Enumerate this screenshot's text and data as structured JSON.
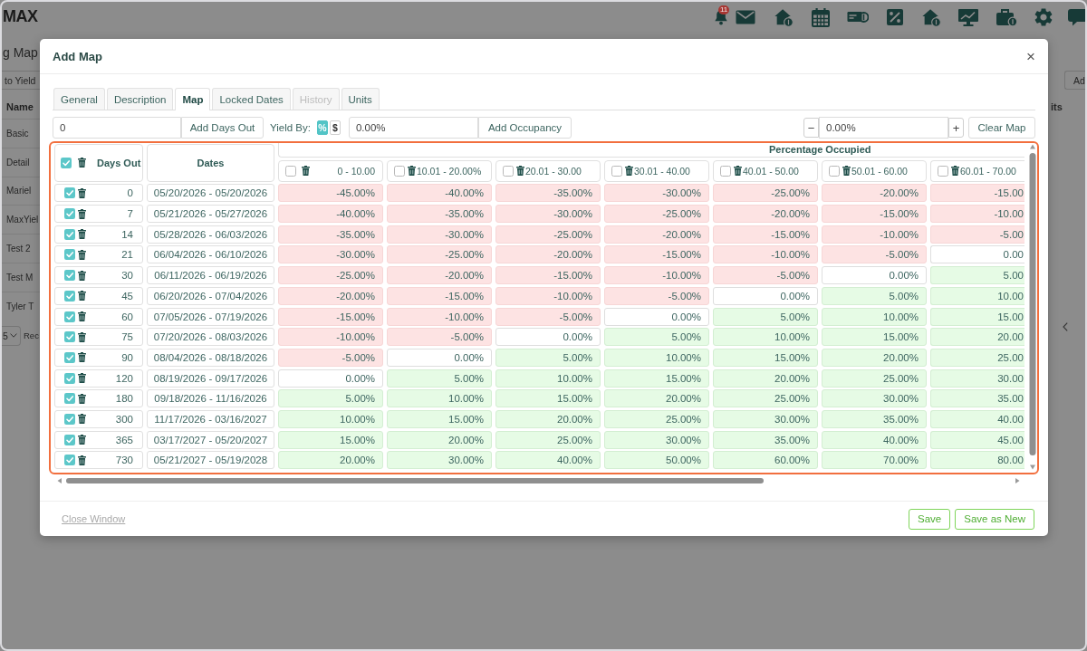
{
  "app_bar": {
    "logo": "MAX",
    "notification_count": "11"
  },
  "background_page": {
    "title": "g Map",
    "yield_button": "to Yield",
    "name_column": "Name",
    "rows": [
      "Basic",
      "Detail",
      "Mariel",
      "MaxYiel",
      "Test 2",
      "Test M",
      "Tyler T"
    ],
    "page_size": "5",
    "records_label": "Rec",
    "add_button": "Ad",
    "column_2": "its"
  },
  "dialog": {
    "title": "Add Map",
    "close": "×",
    "tabs": [
      {
        "label": "General",
        "selected": false,
        "disabled": false
      },
      {
        "label": "Description",
        "selected": false,
        "disabled": false
      },
      {
        "label": "Map",
        "selected": true,
        "disabled": false
      },
      {
        "label": "Locked Dates",
        "selected": false,
        "disabled": false
      },
      {
        "label": "History",
        "selected": false,
        "disabled": true
      },
      {
        "label": "Units",
        "selected": false,
        "disabled": false
      }
    ],
    "toolbar": {
      "days_out_field": {
        "value": "0"
      },
      "add_days_out": "Add Days Out",
      "yield_by_label": "Yield By:",
      "yield_by_options": [
        {
          "label": "%",
          "selected": true
        },
        {
          "label": "$",
          "selected": false
        }
      ],
      "occupancy_field": {
        "value": "0.00%"
      },
      "add_occupancy": "Add Occupancy",
      "decrement": "−",
      "adjust_field": {
        "value": "0.00%"
      },
      "increment": "+",
      "clear_map": "Clear Map"
    },
    "map": {
      "days_header": {
        "label": "Days Out",
        "checked": true
      },
      "dates_header": "Dates",
      "group_header": "Percentage Occupied",
      "columns": [
        {
          "label": "0 - 10.00",
          "checked": false
        },
        {
          "label": "10.01 - 20.00%",
          "checked": false
        },
        {
          "label": "20.01 - 30.00",
          "checked": false
        },
        {
          "label": "30.01 - 40.00",
          "checked": false
        },
        {
          "label": "40.01 - 50.00",
          "checked": false
        },
        {
          "label": "50.01 - 60.00",
          "checked": false
        },
        {
          "label": "60.01 - 70.00",
          "checked": false
        }
      ],
      "rows": [
        {
          "days": "0",
          "checked": true,
          "dates": "05/20/2026 - 05/20/2026",
          "cells": [
            {
              "value": "-45.00%",
              "kind": "down"
            },
            {
              "value": "-40.00%",
              "kind": "down"
            },
            {
              "value": "-35.00%",
              "kind": "down"
            },
            {
              "value": "-30.00%",
              "kind": "down"
            },
            {
              "value": "-25.00%",
              "kind": "down"
            },
            {
              "value": "-20.00%",
              "kind": "down"
            },
            {
              "value": "-15.00",
              "kind": "down"
            }
          ]
        },
        {
          "days": "7",
          "checked": true,
          "dates": "05/21/2026 - 05/27/2026",
          "cells": [
            {
              "value": "-40.00%",
              "kind": "down"
            },
            {
              "value": "-35.00%",
              "kind": "down"
            },
            {
              "value": "-30.00%",
              "kind": "down"
            },
            {
              "value": "-25.00%",
              "kind": "down"
            },
            {
              "value": "-20.00%",
              "kind": "down"
            },
            {
              "value": "-15.00%",
              "kind": "down"
            },
            {
              "value": "-10.00",
              "kind": "down"
            }
          ]
        },
        {
          "days": "14",
          "checked": true,
          "dates": "05/28/2026 - 06/03/2026",
          "cells": [
            {
              "value": "-35.00%",
              "kind": "down"
            },
            {
              "value": "-30.00%",
              "kind": "down"
            },
            {
              "value": "-25.00%",
              "kind": "down"
            },
            {
              "value": "-20.00%",
              "kind": "down"
            },
            {
              "value": "-15.00%",
              "kind": "down"
            },
            {
              "value": "-10.00%",
              "kind": "down"
            },
            {
              "value": "-5.00",
              "kind": "down"
            }
          ]
        },
        {
          "days": "21",
          "checked": true,
          "dates": "06/04/2026 - 06/10/2026",
          "cells": [
            {
              "value": "-30.00%",
              "kind": "down"
            },
            {
              "value": "-25.00%",
              "kind": "down"
            },
            {
              "value": "-20.00%",
              "kind": "down"
            },
            {
              "value": "-15.00%",
              "kind": "down"
            },
            {
              "value": "-10.00%",
              "kind": "down"
            },
            {
              "value": "-5.00%",
              "kind": "down"
            },
            {
              "value": "0.00",
              "kind": "flat"
            }
          ]
        },
        {
          "days": "30",
          "checked": true,
          "dates": "06/11/2026 - 06/19/2026",
          "cells": [
            {
              "value": "-25.00%",
              "kind": "down"
            },
            {
              "value": "-20.00%",
              "kind": "down"
            },
            {
              "value": "-15.00%",
              "kind": "down"
            },
            {
              "value": "-10.00%",
              "kind": "down"
            },
            {
              "value": "-5.00%",
              "kind": "down"
            },
            {
              "value": "0.00%",
              "kind": "flat"
            },
            {
              "value": "5.00",
              "kind": "up"
            }
          ]
        },
        {
          "days": "45",
          "checked": true,
          "dates": "06/20/2026 - 07/04/2026",
          "cells": [
            {
              "value": "-20.00%",
              "kind": "down"
            },
            {
              "value": "-15.00%",
              "kind": "down"
            },
            {
              "value": "-10.00%",
              "kind": "down"
            },
            {
              "value": "-5.00%",
              "kind": "down"
            },
            {
              "value": "0.00%",
              "kind": "flat"
            },
            {
              "value": "5.00%",
              "kind": "up"
            },
            {
              "value": "10.00",
              "kind": "up"
            }
          ]
        },
        {
          "days": "60",
          "checked": true,
          "dates": "07/05/2026 - 07/19/2026",
          "cells": [
            {
              "value": "-15.00%",
              "kind": "down"
            },
            {
              "value": "-10.00%",
              "kind": "down"
            },
            {
              "value": "-5.00%",
              "kind": "down"
            },
            {
              "value": "0.00%",
              "kind": "flat"
            },
            {
              "value": "5.00%",
              "kind": "up"
            },
            {
              "value": "10.00%",
              "kind": "up"
            },
            {
              "value": "15.00",
              "kind": "up"
            }
          ]
        },
        {
          "days": "75",
          "checked": true,
          "dates": "07/20/2026 - 08/03/2026",
          "cells": [
            {
              "value": "-10.00%",
              "kind": "down"
            },
            {
              "value": "-5.00%",
              "kind": "down"
            },
            {
              "value": "0.00%",
              "kind": "flat"
            },
            {
              "value": "5.00%",
              "kind": "up"
            },
            {
              "value": "10.00%",
              "kind": "up"
            },
            {
              "value": "15.00%",
              "kind": "up"
            },
            {
              "value": "20.00",
              "kind": "up"
            }
          ]
        },
        {
          "days": "90",
          "checked": true,
          "dates": "08/04/2026 - 08/18/2026",
          "cells": [
            {
              "value": "-5.00%",
              "kind": "down"
            },
            {
              "value": "0.00%",
              "kind": "flat"
            },
            {
              "value": "5.00%",
              "kind": "up"
            },
            {
              "value": "10.00%",
              "kind": "up"
            },
            {
              "value": "15.00%",
              "kind": "up"
            },
            {
              "value": "20.00%",
              "kind": "up"
            },
            {
              "value": "25.00",
              "kind": "up"
            }
          ]
        },
        {
          "days": "120",
          "checked": true,
          "dates": "08/19/2026 - 09/17/2026",
          "cells": [
            {
              "value": "0.00%",
              "kind": "flat"
            },
            {
              "value": "5.00%",
              "kind": "up"
            },
            {
              "value": "10.00%",
              "kind": "up"
            },
            {
              "value": "15.00%",
              "kind": "up"
            },
            {
              "value": "20.00%",
              "kind": "up"
            },
            {
              "value": "25.00%",
              "kind": "up"
            },
            {
              "value": "30.00",
              "kind": "up"
            }
          ]
        },
        {
          "days": "180",
          "checked": true,
          "dates": "09/18/2026 - 11/16/2026",
          "cells": [
            {
              "value": "5.00%",
              "kind": "up"
            },
            {
              "value": "10.00%",
              "kind": "up"
            },
            {
              "value": "15.00%",
              "kind": "up"
            },
            {
              "value": "20.00%",
              "kind": "up"
            },
            {
              "value": "25.00%",
              "kind": "up"
            },
            {
              "value": "30.00%",
              "kind": "up"
            },
            {
              "value": "35.00",
              "kind": "up"
            }
          ]
        },
        {
          "days": "300",
          "checked": true,
          "dates": "11/17/2026 - 03/16/2027",
          "cells": [
            {
              "value": "10.00%",
              "kind": "up"
            },
            {
              "value": "15.00%",
              "kind": "up"
            },
            {
              "value": "20.00%",
              "kind": "up"
            },
            {
              "value": "25.00%",
              "kind": "up"
            },
            {
              "value": "30.00%",
              "kind": "up"
            },
            {
              "value": "35.00%",
              "kind": "up"
            },
            {
              "value": "40.00",
              "kind": "up"
            }
          ]
        },
        {
          "days": "365",
          "checked": true,
          "dates": "03/17/2027 - 05/20/2027",
          "cells": [
            {
              "value": "15.00%",
              "kind": "up"
            },
            {
              "value": "20.00%",
              "kind": "up"
            },
            {
              "value": "25.00%",
              "kind": "up"
            },
            {
              "value": "30.00%",
              "kind": "up"
            },
            {
              "value": "35.00%",
              "kind": "up"
            },
            {
              "value": "40.00%",
              "kind": "up"
            },
            {
              "value": "45.00",
              "kind": "up"
            }
          ]
        },
        {
          "days": "730",
          "checked": true,
          "dates": "05/21/2027 - 05/19/2028",
          "cells": [
            {
              "value": "20.00%",
              "kind": "up"
            },
            {
              "value": "30.00%",
              "kind": "up"
            },
            {
              "value": "40.00%",
              "kind": "up"
            },
            {
              "value": "50.00%",
              "kind": "up"
            },
            {
              "value": "60.00%",
              "kind": "up"
            },
            {
              "value": "70.00%",
              "kind": "up"
            },
            {
              "value": "80.00",
              "kind": "up"
            }
          ]
        }
      ]
    },
    "footer": {
      "close_link": "Close Window",
      "buttons": [
        "Save",
        "Save as New"
      ]
    }
  }
}
